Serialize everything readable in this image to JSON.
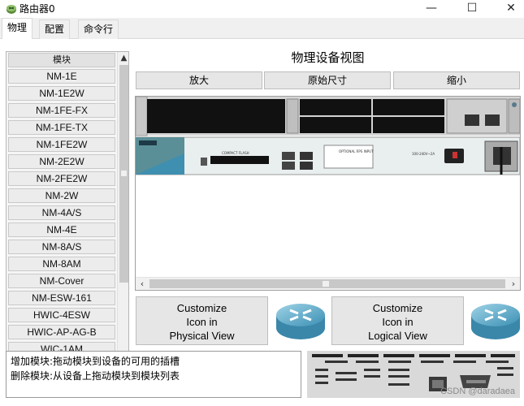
{
  "window": {
    "title": "路由器0",
    "app_icon": "router-device-icon",
    "minimize_glyph": "—",
    "maximize_glyph": "☐",
    "close_glyph": "✕"
  },
  "tabs": [
    {
      "label": "物理",
      "active": true
    },
    {
      "label": "配置",
      "active": false
    },
    {
      "label": "命令行",
      "active": false
    }
  ],
  "modules": {
    "header": "模块",
    "items": [
      "NM-1E",
      "NM-1E2W",
      "NM-1FE-FX",
      "NM-1FE-TX",
      "NM-1FE2W",
      "NM-2E2W",
      "NM-2FE2W",
      "NM-2W",
      "NM-4A/S",
      "NM-4E",
      "NM-8A/S",
      "NM-8AM",
      "NM-Cover",
      "NM-ESW-161",
      "HWIC-4ESW",
      "HWIC-AP-AG-B",
      "WIC-1AM"
    ]
  },
  "device_view": {
    "title": "物理设备视图",
    "zoom_in": "放大",
    "original_size": "原始尺寸",
    "zoom_out": "缩小",
    "panel_label": "OPTIONAL RPS INPUT",
    "compact_flash": "COMPACT FLASH",
    "power_label": "100-240V~2A"
  },
  "customize": {
    "physical": [
      "Customize",
      "Icon in",
      "Physical View"
    ],
    "logical": [
      "Customize",
      "Icon in",
      "Logical View"
    ]
  },
  "help": {
    "add": "增加模块:拖动模块到设备的可用的插槽",
    "remove": "删除模块:从设备上拖动模块到模块列表"
  },
  "preview": {
    "watermark": "CSDN @daradaea"
  },
  "colors": {
    "router_blue": "#3f8fb0",
    "chassis_teal": "#5a8f97",
    "panel_dark": "#111111"
  }
}
